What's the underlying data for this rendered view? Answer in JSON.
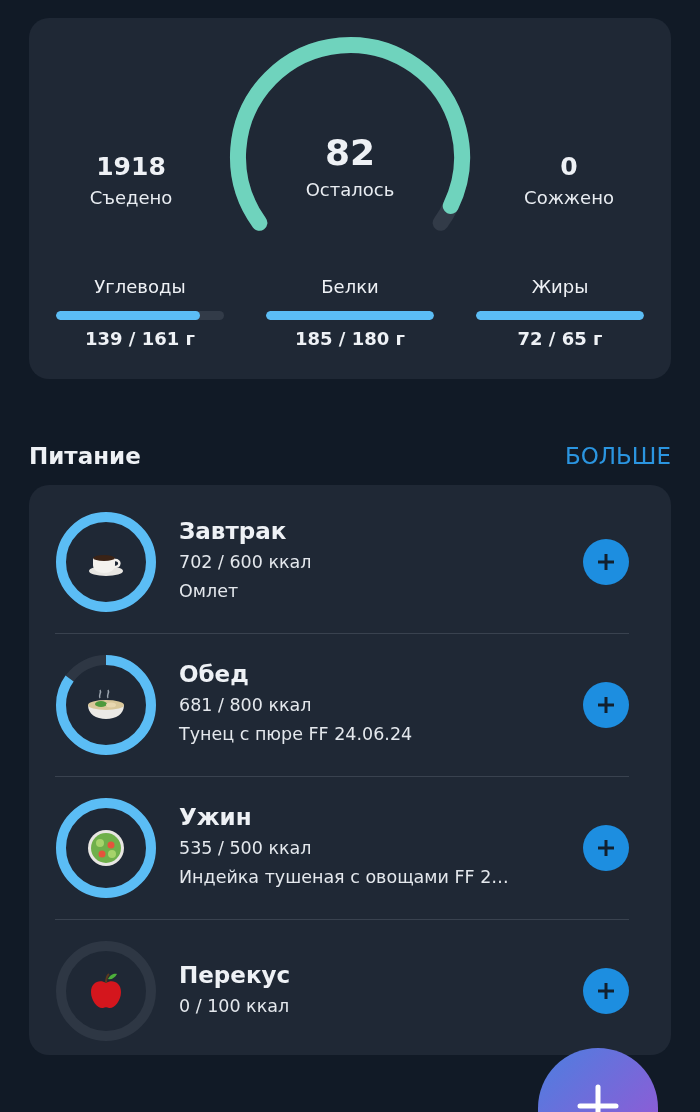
{
  "summary": {
    "eaten": {
      "value": "1918",
      "label": "Съедено"
    },
    "remaining": {
      "value": "82",
      "label": "Осталось",
      "level": 0.96
    },
    "burned": {
      "value": "0",
      "label": "Сожжено"
    }
  },
  "macros": [
    {
      "name": "Углеводы",
      "level": 0.86,
      "reading": "139 / 161 г"
    },
    {
      "name": "Белки",
      "level": 1,
      "reading": "185 / 180 г"
    },
    {
      "name": "Жиры",
      "level": 1,
      "reading": "72 / 65 г"
    }
  ],
  "nutrition": {
    "title": "Питание",
    "more": "БОЛЬШЕ",
    "meals": [
      {
        "kind": "coffee",
        "name": "Завтрак",
        "calories": "702 / 600 ккал",
        "foods": "Омлет",
        "level": 1
      },
      {
        "kind": "soup",
        "name": "Обед",
        "calories": "681 / 800 ккал",
        "foods": "Тунец с пюре FF 24.06.24",
        "level": 0.85
      },
      {
        "kind": "salad",
        "name": "Ужин",
        "calories": "535 / 500 ккал",
        "foods": "Индейка тушеная с овощами FF 2…",
        "level": 1
      },
      {
        "kind": "apple",
        "name": "Перекус",
        "calories": "0 / 100 ккал",
        "level": 0
      }
    ]
  }
}
